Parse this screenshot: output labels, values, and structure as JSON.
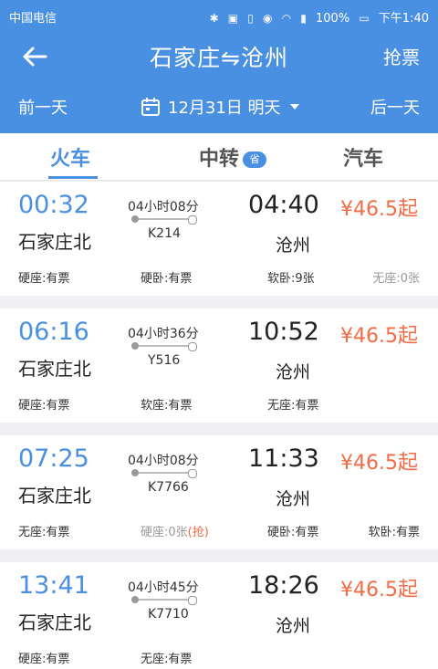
{
  "status_bar": {
    "carrier": "中国电信",
    "battery": "100%",
    "time": "下午1:40"
  },
  "nav": {
    "title": "石家庄⇋沧州",
    "grab_label": "抢票"
  },
  "date_bar": {
    "prev_label": "前一天",
    "date_label": "12月31日 明天",
    "next_label": "后一天"
  },
  "tabs": {
    "train": "火车",
    "transfer": "中转",
    "transfer_badge": "省",
    "bus": "汽车"
  },
  "trains": [
    {
      "dep_time": "00:32",
      "dep_station": "石家庄北",
      "duration": "04小时08分",
      "train_no": "K214",
      "arr_time": "04:40",
      "arr_station": "沧州",
      "price": "¥46.5起",
      "seats": [
        "硬座:有票",
        "硬卧:有票",
        "软卧:9张",
        "无座:0张"
      ]
    },
    {
      "dep_time": "06:16",
      "dep_station": "石家庄北",
      "duration": "04小时36分",
      "train_no": "Y516",
      "arr_time": "10:52",
      "arr_station": "沧州",
      "price": "¥46.5起",
      "seats": [
        "硬座:有票",
        "软座:有票",
        "无座:有票"
      ]
    },
    {
      "dep_time": "07:25",
      "dep_station": "石家庄北",
      "duration": "04小时08分",
      "train_no": "K7766",
      "arr_time": "11:33",
      "arr_station": "沧州",
      "price": "¥46.5起",
      "seats": [
        "无座:有票",
        "硬座:0张",
        "硬卧:有票",
        "软卧:有票"
      ],
      "seat2_grab": "(抢)"
    },
    {
      "dep_time": "13:41",
      "dep_station": "石家庄北",
      "duration": "04小时45分",
      "train_no": "K7710",
      "arr_time": "18:26",
      "arr_station": "沧州",
      "price": "¥46.5起",
      "seats": [
        "硬座:有票",
        "无座:有票"
      ]
    }
  ]
}
